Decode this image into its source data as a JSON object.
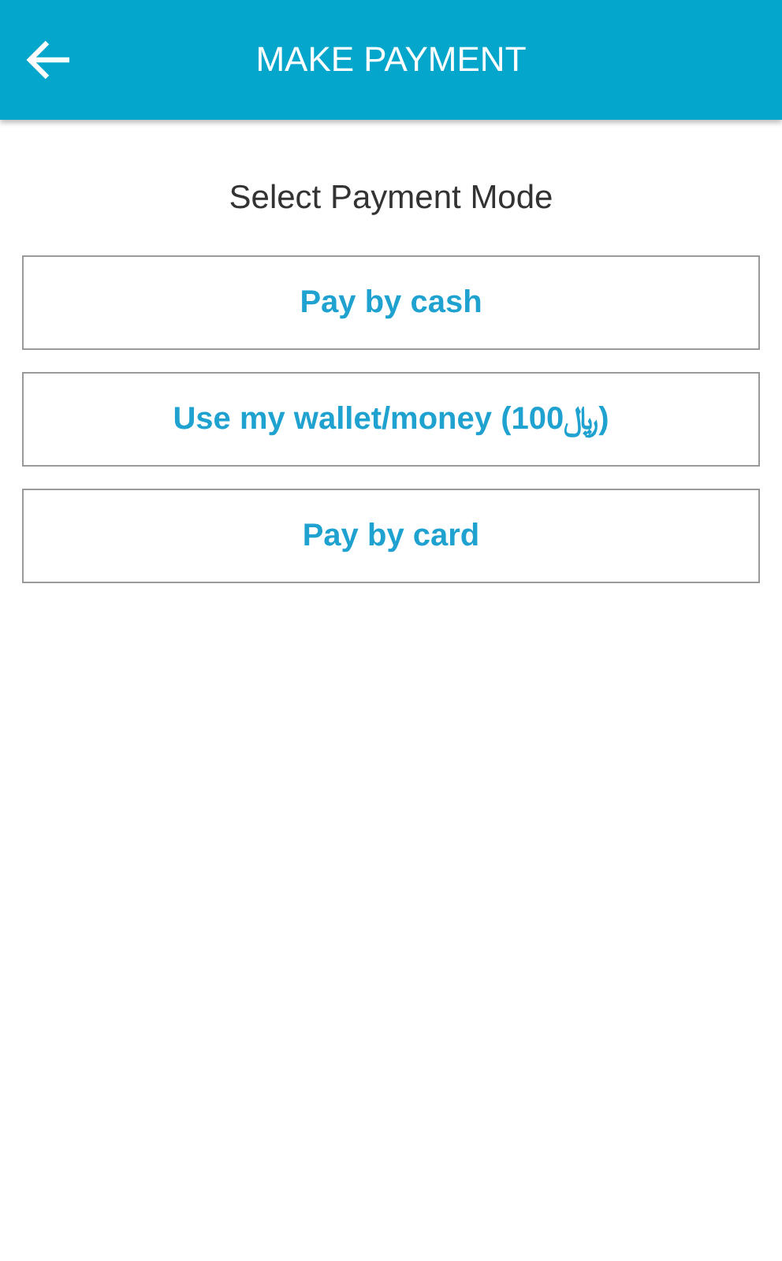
{
  "app_bar": {
    "title": "MAKE PAYMENT"
  },
  "heading": "Select Payment Mode",
  "options": [
    {
      "label": "Pay by cash"
    },
    {
      "label": "Use my wallet/money (100﷼)"
    },
    {
      "label": "Pay by card"
    }
  ]
}
